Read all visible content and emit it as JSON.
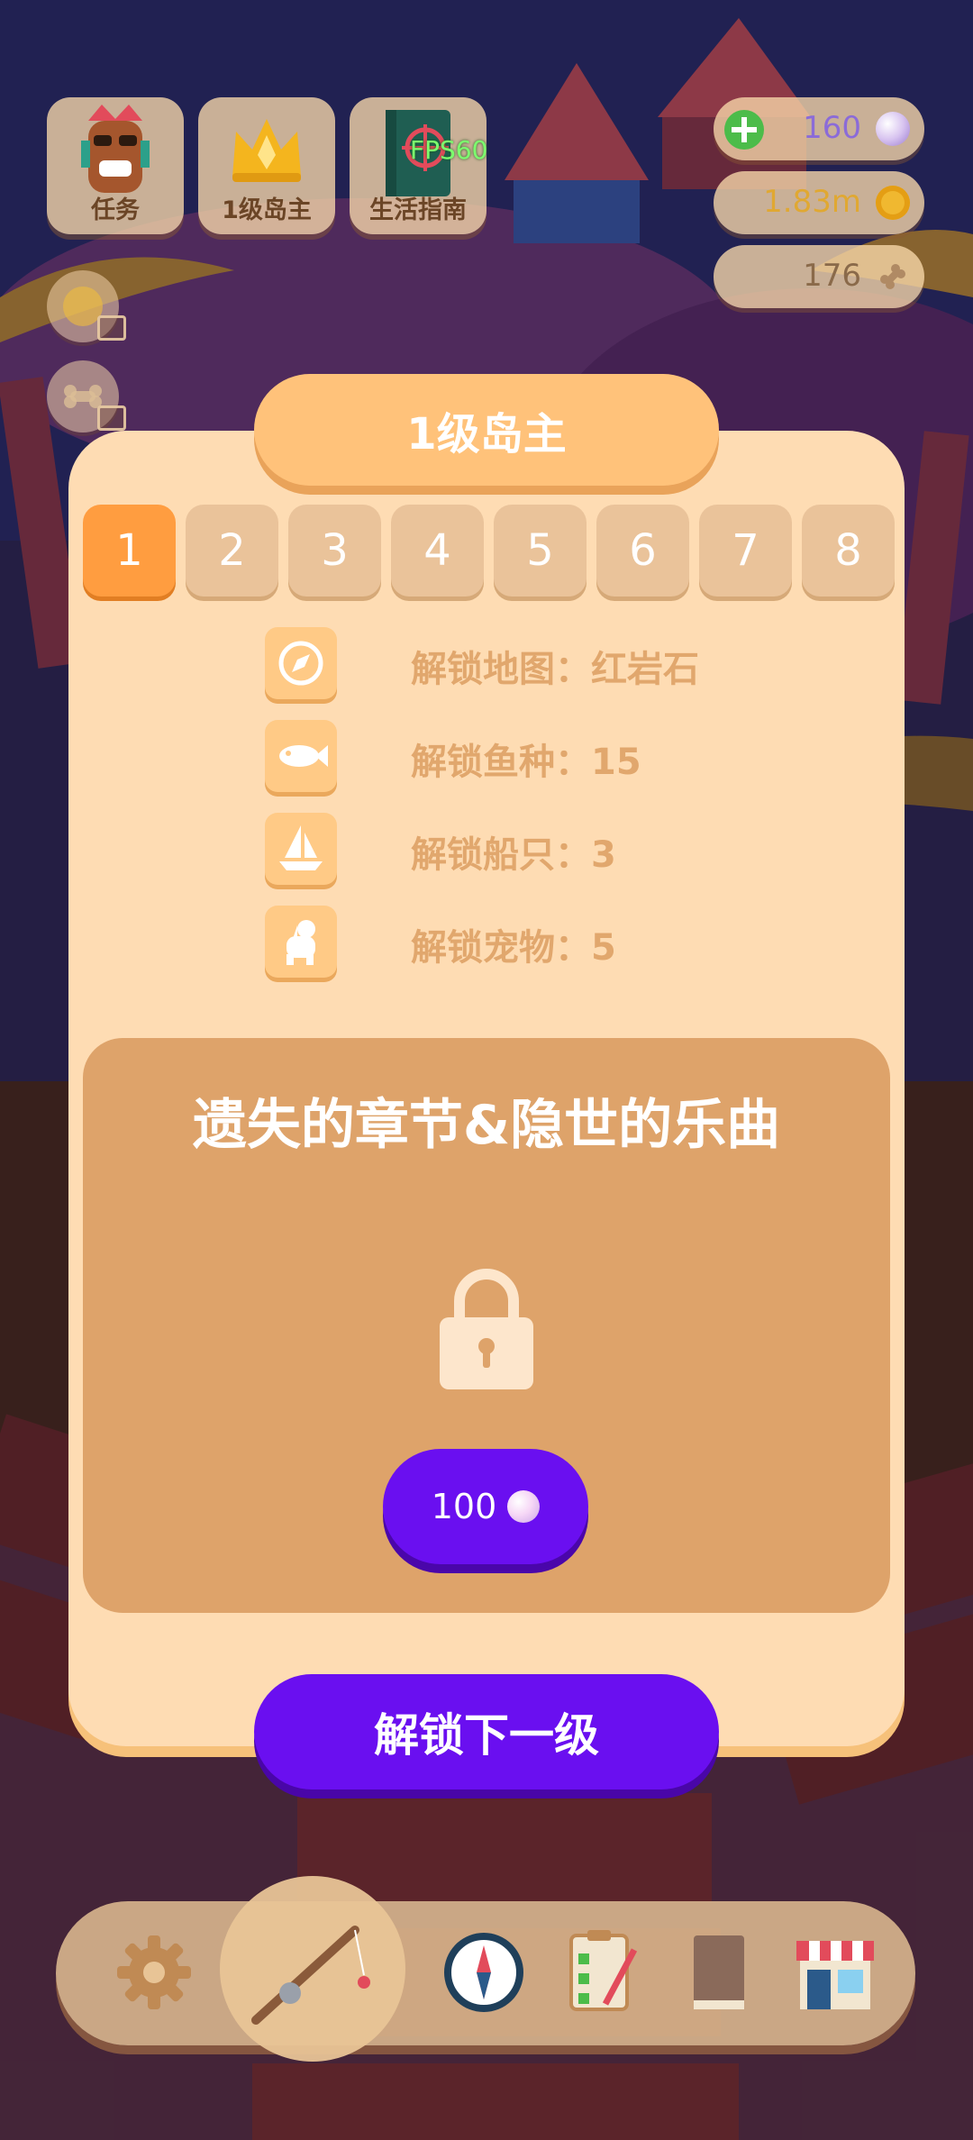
{
  "hud": {
    "tasks_label": "任务",
    "rank_label": "1级岛主",
    "guide_label": "生活指南",
    "fps_label": "FPS60"
  },
  "currency": {
    "pearls": "160",
    "coins": "1.83m",
    "bones": "176"
  },
  "modal": {
    "title": "1级岛主",
    "tabs": [
      "1",
      "2",
      "3",
      "4",
      "5",
      "6",
      "7",
      "8"
    ],
    "active_tab": "1",
    "perks": [
      {
        "icon": "compass-icon",
        "text": "解锁地图：红岩石"
      },
      {
        "icon": "fish-icon",
        "text": "解锁鱼种：15"
      },
      {
        "icon": "sailboat-icon",
        "text": "解锁船只：3"
      },
      {
        "icon": "dog-icon",
        "text": "解锁宠物：5"
      }
    ],
    "locked_section": {
      "title": "遗失的章节&隐世的乐曲",
      "price": "100"
    },
    "next_button": "解锁下一级"
  },
  "colors": {
    "modal_bg": "#fedcb3",
    "accent_orange": "#ff9d40",
    "purple_button": "#6a0ff0",
    "locked_panel": "#dea36a"
  },
  "nav": {
    "items": [
      "gear-icon",
      "fishing-rod-icon",
      "compass-icon",
      "checklist-icon",
      "book-icon",
      "shop-icon"
    ]
  }
}
